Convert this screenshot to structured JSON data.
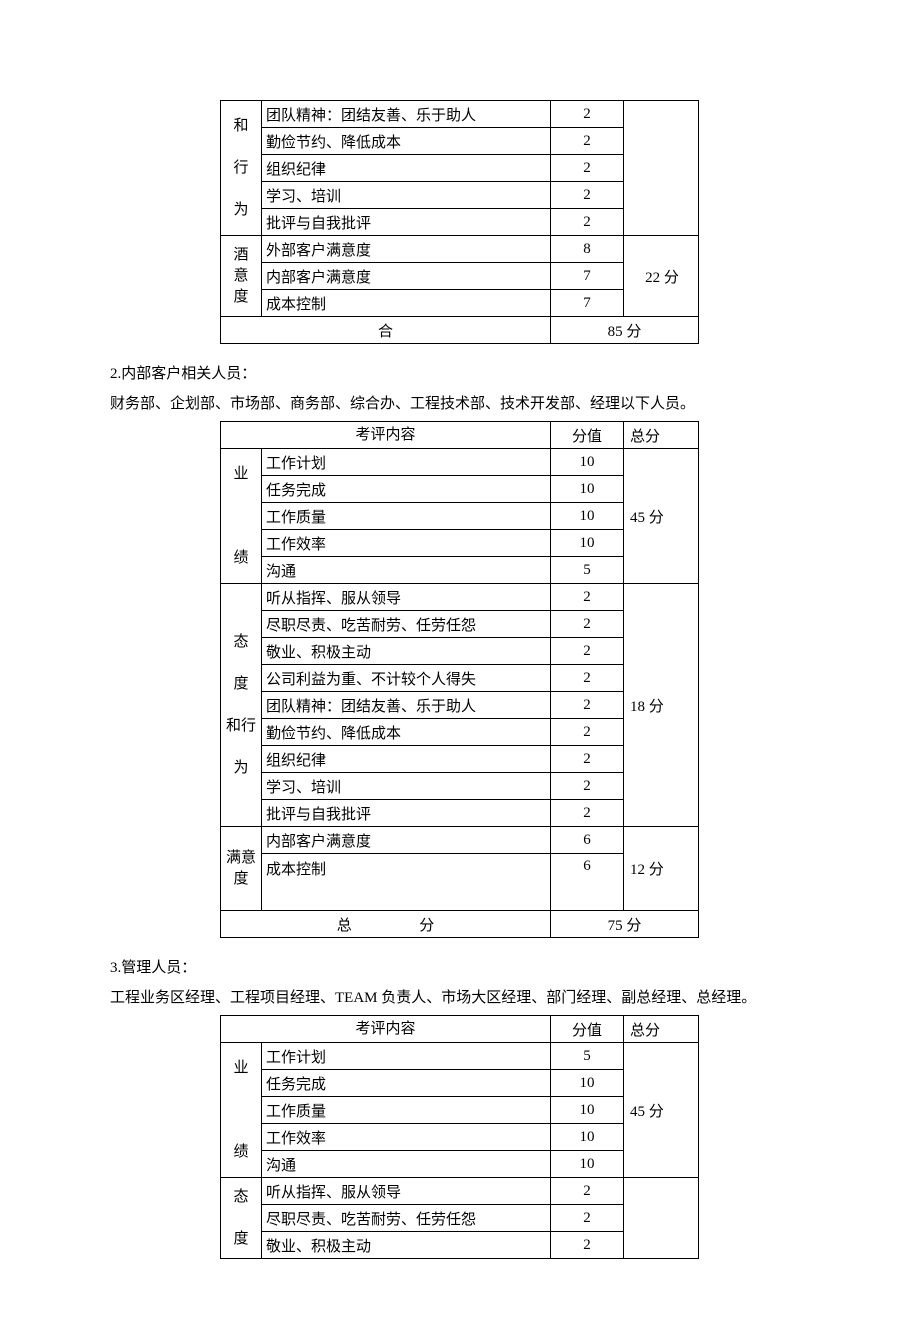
{
  "table1": {
    "cat1": "和\n\n行\n\n为",
    "cat2": "酒\n意\n度",
    "rows1": [
      {
        "item": "团队精神：团结友善、乐于助人",
        "score": "2"
      },
      {
        "item": "勤俭节约、降低成本",
        "score": "2"
      },
      {
        "item": "组织纪律",
        "score": "2"
      },
      {
        "item": "学习、培训",
        "score": "2"
      },
      {
        "item": "批评与自我批评",
        "score": "2"
      }
    ],
    "rows2": [
      {
        "item": "外部客户满意度",
        "score": "8"
      },
      {
        "item": "内部客户满意度",
        "score": "7"
      },
      {
        "item": "成本控制",
        "score": "7"
      }
    ],
    "subtotal2": "22 分",
    "footerL": "合",
    "footerR": "85 分"
  },
  "sec2": {
    "title": "2.内部客户相关人员：",
    "desc": "财务部、企划部、市场部、商务部、综合办、工程技术部、技术开发部、经理以下人员。"
  },
  "table2": {
    "hdr_item": "考评内容",
    "hdr_score": "分值",
    "hdr_total": "总分",
    "cat1": "业\n\n\n\n绩",
    "cat2": "态\n\n度\n\n和行\n\n为",
    "cat3": "满意\n度",
    "rows1": [
      {
        "item": "工作计划",
        "score": "10"
      },
      {
        "item": "任务完成",
        "score": "10"
      },
      {
        "item": "工作质量",
        "score": "10"
      },
      {
        "item": "工作效率",
        "score": "10"
      },
      {
        "item": "沟通",
        "score": "5"
      }
    ],
    "sub1": "45 分",
    "rows2": [
      {
        "item": "听从指挥、服从领导",
        "score": "2"
      },
      {
        "item": "尽职尽责、吃苦耐劳、任劳任怨",
        "score": "2"
      },
      {
        "item": "敬业、积极主动",
        "score": "2"
      },
      {
        "item": "公司利益为重、不计较个人得失",
        "score": "2"
      },
      {
        "item": "团队精神：团结友善、乐于助人",
        "score": "2"
      },
      {
        "item": "勤俭节约、降低成本",
        "score": "2"
      },
      {
        "item": "组织纪律",
        "score": "2"
      },
      {
        "item": "学习、培训",
        "score": "2"
      },
      {
        "item": "批评与自我批评",
        "score": "2"
      }
    ],
    "sub2": "18 分",
    "rows3": [
      {
        "item": "内部客户满意度",
        "score": "6"
      },
      {
        "item": "成本控制",
        "score": "6"
      }
    ],
    "sub3": "12 分",
    "footerL": "总",
    "footerM": "分",
    "footerR": "75 分"
  },
  "sec3": {
    "title": "3.管理人员：",
    "desc": "工程业务区经理、工程项目经理、TEAM 负责人、市场大区经理、部门经理、副总经理、总经理。"
  },
  "table3": {
    "hdr_item": "考评内容",
    "hdr_score": "分值",
    "hdr_total": "总分",
    "cat1": "业\n\n\n\n绩",
    "cat2": "态\n\n度",
    "rows1": [
      {
        "item": "工作计划",
        "score": "5"
      },
      {
        "item": "任务完成",
        "score": "10"
      },
      {
        "item": "工作质量",
        "score": "10"
      },
      {
        "item": "工作效率",
        "score": "10"
      },
      {
        "item": "沟通",
        "score": "10"
      }
    ],
    "sub1": "45 分",
    "rows2": [
      {
        "item": "听从指挥、服从领导",
        "score": "2"
      },
      {
        "item": "尽职尽责、吃苦耐劳、任劳任怨",
        "score": "2"
      },
      {
        "item": "敬业、积极主动",
        "score": "2"
      }
    ]
  }
}
